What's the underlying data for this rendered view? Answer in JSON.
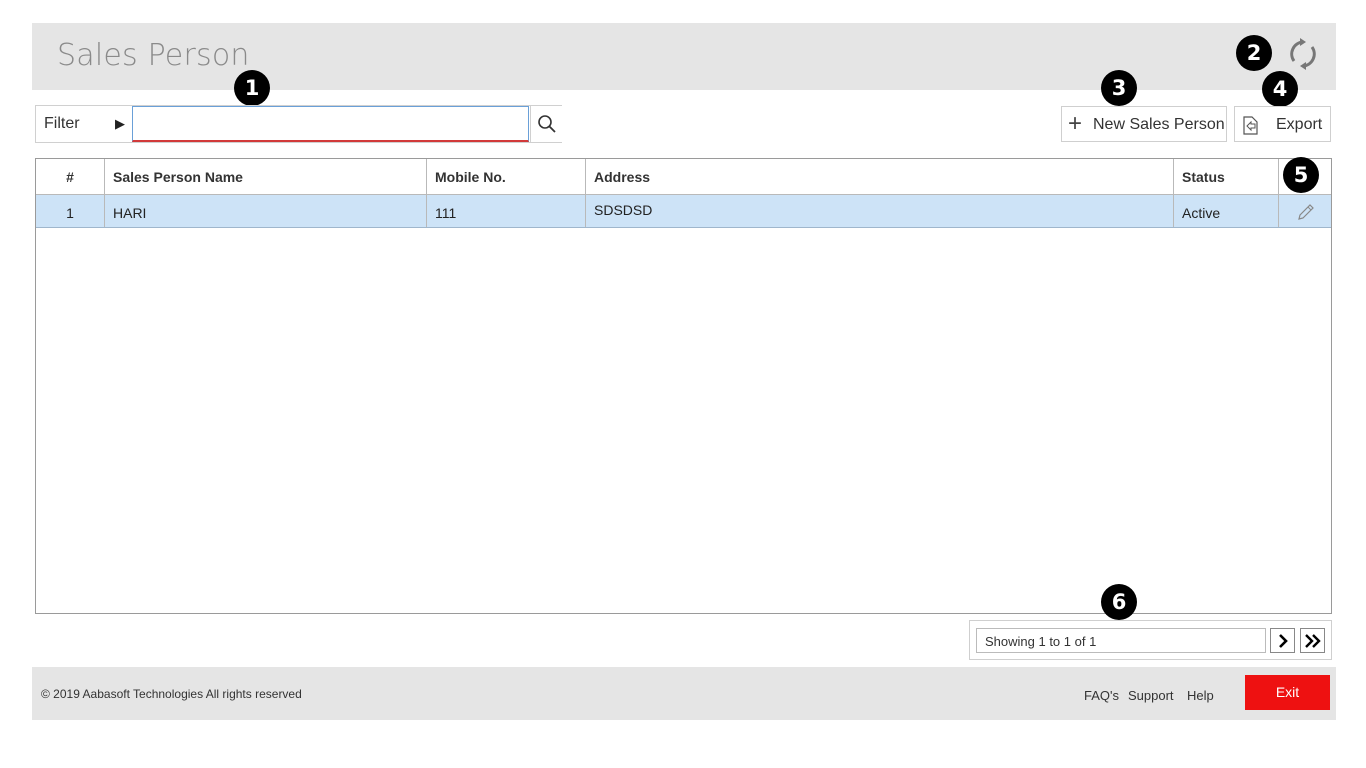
{
  "header": {
    "title": "Sales Person",
    "refresh_icon": "refresh-icon"
  },
  "markers": [
    "1",
    "2",
    "3",
    "4",
    "5",
    "6"
  ],
  "filter": {
    "label": "Filter",
    "arrow": "▶",
    "input_value": "",
    "search_icon": "search-icon"
  },
  "toolbar": {
    "new_label": "New Sales Person",
    "new_icon": "+",
    "export_label": "Export",
    "export_icon": "export-icon"
  },
  "grid": {
    "columns": [
      "#",
      "Sales Person Name",
      "Mobile No.",
      "Address",
      "Status",
      ""
    ],
    "rows": [
      {
        "num": "1",
        "name": "HARI",
        "mobile": "111",
        "address": "SDSDSD",
        "status": "Active",
        "action_icon": "edit-icon"
      }
    ],
    "selected_row_color": "#cde3f7"
  },
  "pager": {
    "info": "Showing 1 to 1 of 1",
    "next_icon": "chevron-right-icon",
    "last_icon": "double-chevron-right-icon"
  },
  "footer": {
    "copyright": "© 2019 Aabasoft Technologies All rights reserved",
    "links": [
      "FAQ's",
      "Support",
      "Help"
    ],
    "exit_label": "Exit",
    "exit_color": "#ee1111"
  }
}
